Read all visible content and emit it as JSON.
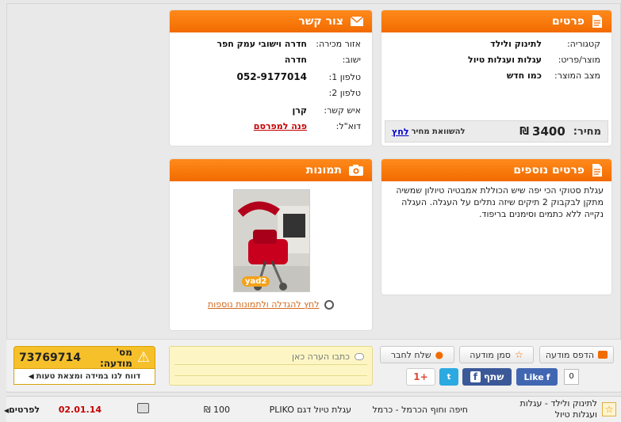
{
  "details": {
    "title": "פרטים",
    "category_label": "קטגוריה:",
    "category_value": "לתינוק ולילד",
    "product_label": "מוצר/פריט:",
    "product_value": "עגלות ועגלות טיול",
    "condition_label": "מצב המוצר:",
    "condition_value": "כמו חדש",
    "price_label": "מחיר:",
    "price_value": "3400",
    "currency": "₪",
    "compare_text": "להשוואת מחיר",
    "compare_link": "לחץ"
  },
  "contact": {
    "title": "צור קשר",
    "area_label": "אזור מכירה:",
    "area_value": "חדרה וישובי עמק חפר",
    "city_label": "ישוב:",
    "city_value": "חדרה",
    "phone1_label": "טלפון 1:",
    "phone1_value": "052-9177014",
    "phone2_label": "טלפון 2:",
    "contact_label": "איש קשר:",
    "contact_value": "קרן",
    "email_label": "דוא\"ל:",
    "email_link": "פנה למפרסם"
  },
  "more": {
    "title": "פרטים נוספים",
    "text": "עגלת סטוקי הכי יפה שיש הכוללת אמבטיה טיולון שמשיה מתקן לבקבוק 2 תיקים שיזה נתלים על העגלה. העגלה נקייה ללא כתמים וסימנים בריפוד."
  },
  "photos": {
    "title": "תמונות",
    "watermark": "yad2",
    "enlarge_link": "לחץ להגדלה ולתמונות נוספות"
  },
  "actions": {
    "print": "הדפס מודעה",
    "save": "סמן מודעה",
    "send": "שלח לחבר",
    "note_placeholder": "כתבו הערה כאן",
    "share": "שתף",
    "like": "Like",
    "like_count": "0",
    "gplus": "+1"
  },
  "ad": {
    "number_label": "מס' מודעה:",
    "number_value": "73769714",
    "report": "דווח לנו במידה ומצאת טעות"
  },
  "listing": {
    "category": "לתינוק ולילד - עגלות ועגלות טיול",
    "area": "חיפה וחוף הכרמל - כרמל",
    "title": "עגלת טיול דגם PLIKO",
    "price": "100 ₪",
    "date": "02.01.14",
    "details": "לפרטים"
  },
  "colors": {
    "accent": "#f57a0a",
    "red": "#c40000"
  }
}
